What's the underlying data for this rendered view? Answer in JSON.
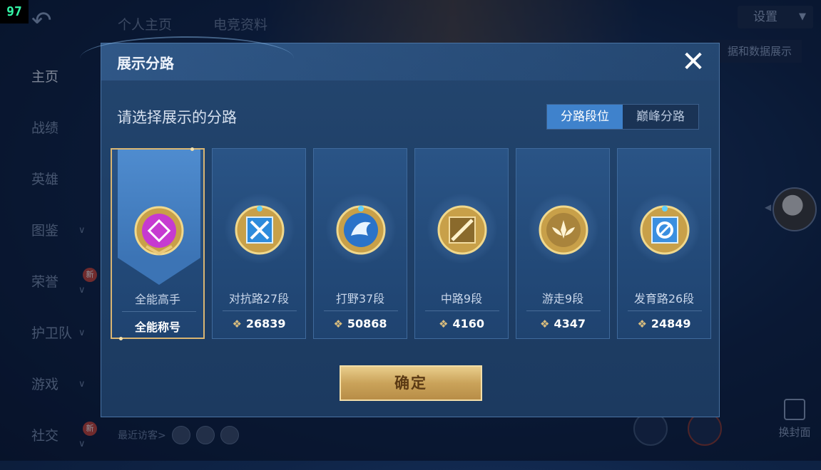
{
  "fps": "97",
  "top_tabs": [
    "个人主页",
    "电竞资料"
  ],
  "settings": {
    "label": "设置"
  },
  "data_display": "据和数据展示",
  "sidebar": {
    "items": [
      {
        "label": "主页"
      },
      {
        "label": "战绩"
      },
      {
        "label": "英雄"
      },
      {
        "label": "图鉴"
      },
      {
        "label": "荣誉",
        "badge": "新"
      },
      {
        "label": "护卫队"
      },
      {
        "label": "游戏"
      },
      {
        "label": "社交",
        "badge": "新"
      }
    ]
  },
  "visitors": {
    "label": "最近访客>"
  },
  "change_cover": "换封面",
  "modal": {
    "title": "展示分路",
    "close": "✕",
    "prompt": "请选择展示的分路",
    "segments": [
      "分路段位",
      "巅峰分路"
    ],
    "active_segment": "分路段位",
    "cards": [
      {
        "role": "全能高手",
        "score": "全能称号",
        "icon": "all-round-master-icon",
        "color": "#c63ad1",
        "selected": true
      },
      {
        "role": "对抗路27段",
        "score": "26839",
        "icon": "clash-lane-icon",
        "color": "#2d8bdc",
        "selected": false
      },
      {
        "role": "打野37段",
        "score": "50868",
        "icon": "jungle-icon",
        "color": "#2a73c9",
        "selected": false
      },
      {
        "role": "中路9段",
        "score": "4160",
        "icon": "mid-lane-icon",
        "color": "#8a6a2c",
        "selected": false
      },
      {
        "role": "游走9段",
        "score": "4347",
        "icon": "roam-icon",
        "color": "#a9843c",
        "selected": false
      },
      {
        "role": "发育路26段",
        "score": "24849",
        "icon": "farm-lane-icon",
        "color": "#3a8fe0",
        "selected": false
      }
    ],
    "confirm": "确定"
  }
}
